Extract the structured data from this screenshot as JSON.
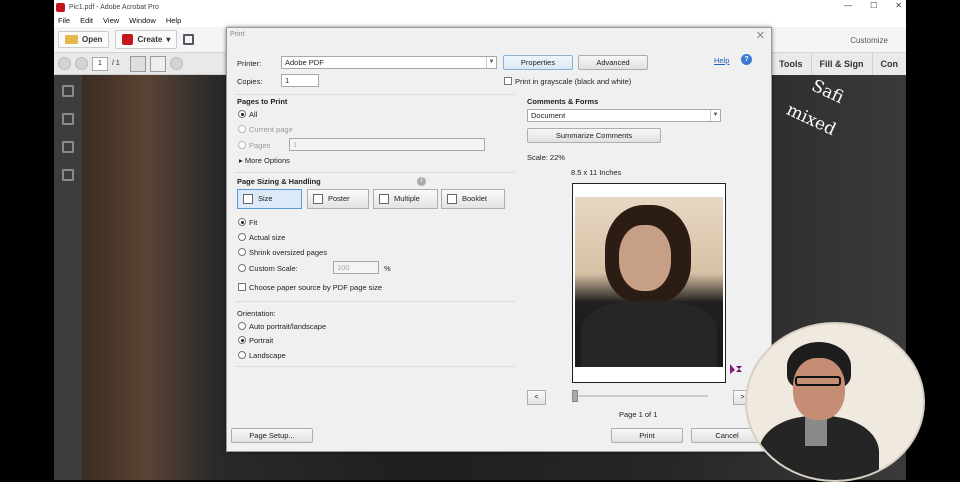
{
  "window": {
    "title": "Pic1.pdf - Adobe Acrobat Pro"
  },
  "menu": [
    "File",
    "Edit",
    "View",
    "Window",
    "Help"
  ],
  "toolbar": {
    "open": "Open",
    "create": "Create",
    "customize": "Customize"
  },
  "nav": {
    "page": "1",
    "total": "/ 1"
  },
  "right_tools": [
    "Tools",
    "Fill & Sign",
    "Con"
  ],
  "dialog": {
    "title": "Print",
    "help": "Help",
    "printer_label": "Printer:",
    "printer_value": "Adobe PDF",
    "properties": "Properties",
    "advanced": "Advanced",
    "copies_label": "Copies:",
    "copies_value": "1",
    "grayscale": "Print in grayscale (black and white)",
    "pages_to_print": {
      "heading": "Pages to Print",
      "all": "All",
      "current": "Current page",
      "pages": "Pages",
      "pages_value": "1",
      "more": "More Options"
    },
    "sizing": {
      "heading": "Page Sizing & Handling",
      "tabs": [
        "Size",
        "Poster",
        "Multiple",
        "Booklet"
      ],
      "fit": "Fit",
      "actual": "Actual size",
      "shrink": "Shrink oversized pages",
      "custom": "Custom Scale:",
      "custom_value": "100",
      "percent": "%",
      "paper_source": "Choose paper source by PDF page size"
    },
    "orientation": {
      "heading": "Orientation:",
      "auto": "Auto portrait/landscape",
      "portrait": "Portrait",
      "landscape": "Landscape"
    },
    "comments": {
      "heading": "Comments & Forms",
      "value": "Document",
      "summarize": "Summarize Comments"
    },
    "scale": "Scale:  22%",
    "paper_size": "8.5 x 11 Inches",
    "page_counter": "Page 1 of 1",
    "prev": "<",
    "next": ">",
    "page_setup": "Page Setup...",
    "print": "Print",
    "cancel": "Cancel"
  },
  "watermark": {
    "line1": "Safi",
    "line2": "mixed"
  }
}
